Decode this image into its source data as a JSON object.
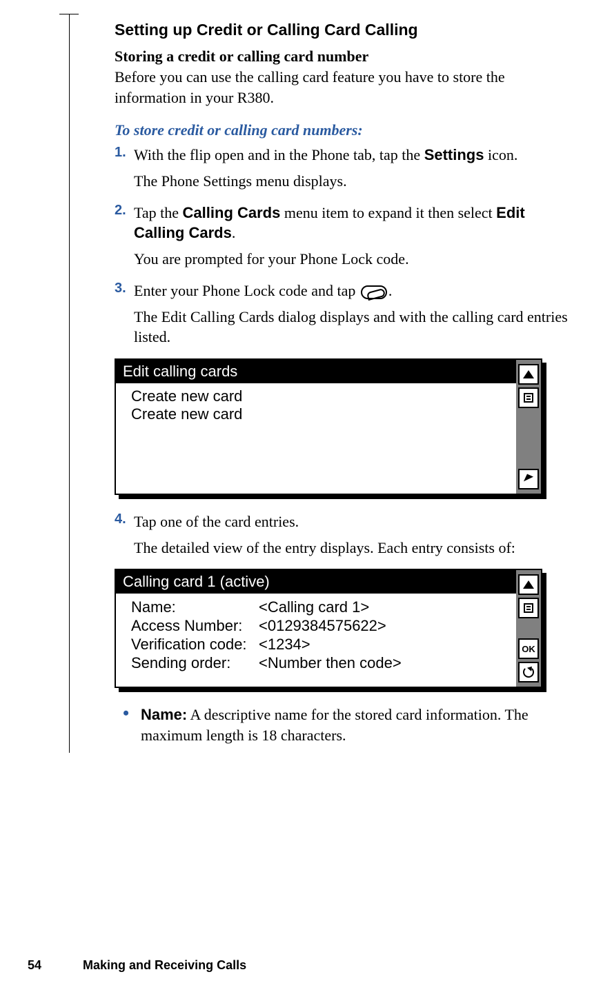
{
  "heading": "Setting up Credit or Calling Card Calling",
  "subheading": "Storing a credit or calling card number",
  "intro": "Before you can use the calling card feature you have to store the information in your R380.",
  "procedure_title": "To store credit or calling card numbers:",
  "steps": {
    "s1": {
      "num": "1.",
      "p1a": "With the flip open and in the Phone tab, tap the ",
      "p1b_ui": "Settings",
      "p1c": " icon.",
      "r1": "The Phone Settings menu displays."
    },
    "s2": {
      "num": "2.",
      "p1a": "Tap the ",
      "p1b_ui": "Calling Cards",
      "p1c": " menu item to expand it then select ",
      "p1d_ui": "Edit Calling Cards",
      "p1e": ".",
      "r1": "You are prompted for your Phone Lock code."
    },
    "s3": {
      "num": "3.",
      "p1a": "Enter your Phone Lock code and tap ",
      "p1b": ".",
      "r1": "The Edit Calling Cards dialog displays and with the calling card entries listed."
    },
    "s4": {
      "num": "4.",
      "p1": "Tap one of the card entries.",
      "r1": "The detailed view of the entry displays. Each entry consists of:"
    }
  },
  "screenshot1": {
    "title": "Edit calling cards",
    "items": [
      "Create new card",
      "Create new card"
    ]
  },
  "screenshot2": {
    "title": "Calling card 1 (active)",
    "rows": [
      {
        "label": "Name:",
        "value": "<Calling card 1>"
      },
      {
        "label": "Access Number:",
        "value": "<0129384575622>"
      },
      {
        "label": "Verification code:",
        "value": "<1234>"
      },
      {
        "label": "Sending order:",
        "value": "<Number then code>"
      }
    ]
  },
  "bullet": {
    "label": "Name:",
    "text": " A descriptive name for the stored card information. The maximum length is 18 characters."
  },
  "sidebuttons": {
    "ok": "OK"
  },
  "footer": {
    "page": "54",
    "chapter": "Making and Receiving Calls"
  }
}
